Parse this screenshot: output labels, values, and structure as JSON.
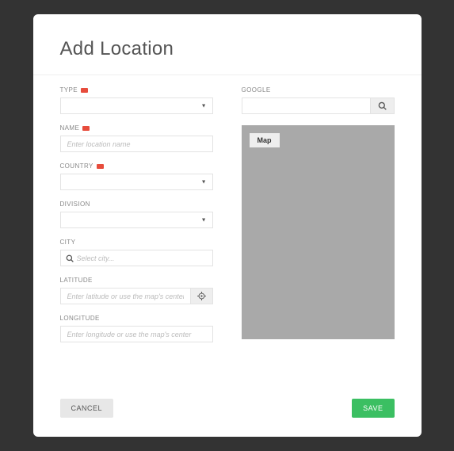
{
  "title": "Add Location",
  "labels": {
    "type": "TYPE",
    "name": "NAME",
    "country": "COUNTRY",
    "division": "DIVISION",
    "city": "CITY",
    "latitude": "LATITUDE",
    "longitude": "LONGITUDE",
    "google": "GOOGLE"
  },
  "placeholders": {
    "name": "Enter location name",
    "city": "Select city...",
    "latitude": "Enter latitude or use the map's center",
    "longitude": "Enter longitude or use the map's center"
  },
  "map": {
    "label": "Map"
  },
  "buttons": {
    "cancel": "CANCEL",
    "save": "SAVE"
  }
}
